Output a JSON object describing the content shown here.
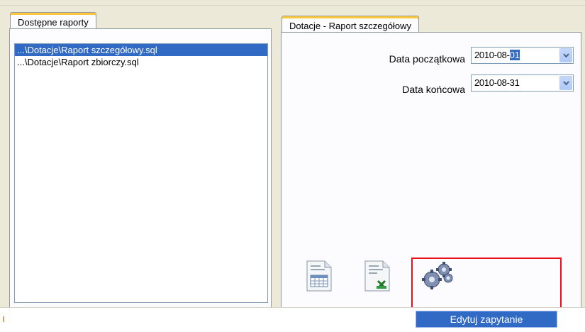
{
  "left_panel": {
    "tab_label": "Dostępne raporty",
    "items": [
      {
        "label": "...\\Dotacje\\Raport szczegółowy.sql",
        "selected": true
      },
      {
        "label": "...\\Dotacje\\Raport zbiorczy.sql",
        "selected": false
      }
    ]
  },
  "right_panel": {
    "tab_label": "Dotacje - Raport szczegółowy",
    "start_date": {
      "label": "Data początkowa",
      "value_prefix": "2010-08-",
      "value_selected": "01"
    },
    "end_date": {
      "label": "Data końcowa",
      "value": "2010-08-31"
    }
  },
  "toolbar": {
    "buttons": [
      {
        "icon": "table-report-icon"
      },
      {
        "icon": "excel-export-icon"
      },
      {
        "icon": "gears-icon"
      }
    ]
  },
  "context_menu": {
    "item_label": "Edytuj zapytanie"
  },
  "colors": {
    "selection": "#316ac5",
    "highlight_border": "#e8101a",
    "tab_accent": "#ffc83c"
  }
}
